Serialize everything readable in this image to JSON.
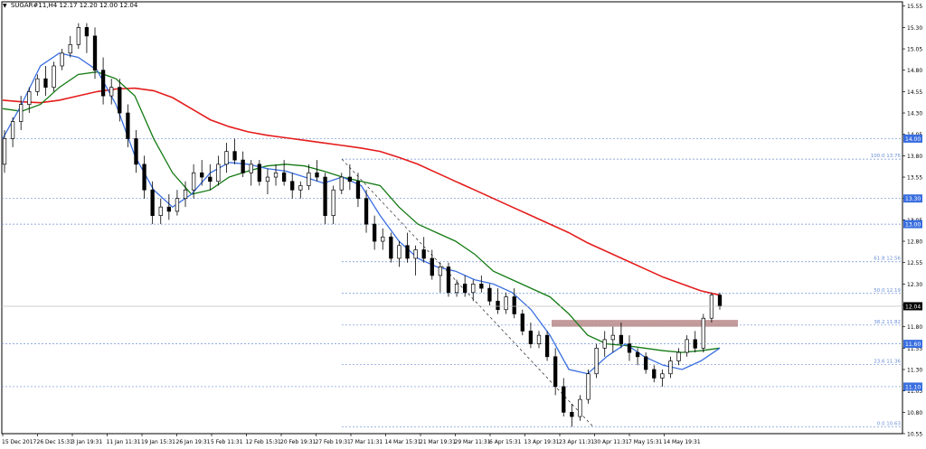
{
  "header": {
    "symbol": "SUGAR#11,H4",
    "ohlc": "12.17 12.20 12.00 12.04"
  },
  "icons": {
    "menu": "triangle-down-icon"
  },
  "colors": {
    "background": "#ffffff",
    "grid": "#6b8fd6",
    "candle": "#000000",
    "ma_red": "#e51c1c",
    "ma_green": "#137a13",
    "ma_blue": "#3a6fe0",
    "zone": "#b98a8a",
    "price_label_bg": "#3a6fe0",
    "current_label_bg": "#000000"
  },
  "chart_data": {
    "type": "candlestick",
    "symbol": "SUGAR#11",
    "timeframe": "H4",
    "ylim": [
      10.55,
      15.6
    ],
    "y_ticks": [
      "15.55",
      "15.30",
      "15.05",
      "14.80",
      "14.55",
      "14.30",
      "14.05",
      "13.80",
      "13.55",
      "13.30",
      "13.05",
      "12.80",
      "12.55",
      "12.30",
      "12.05",
      "11.80",
      "11.55",
      "11.30",
      "11.05",
      "10.80",
      "10.55"
    ],
    "x_tick_labels": [
      "15 Dec 2017",
      "26 Dec 15:31",
      "3 Jan 19:31",
      "11 Jan 11:31",
      "19 Jan 15:31",
      "26 Jan 19:31",
      "5 Feb 11:31",
      "12 Feb 15:31",
      "20 Feb 19:31",
      "27 Feb 19:31",
      "7 Mar 11:31",
      "14 Mar 15:31",
      "21 Mar 19:31",
      "29 Mar 11:31",
      "6 Apr 15:31",
      "13 Apr 19:31",
      "23 Apr 11:31",
      "30 Apr 11:31",
      "7 May 15:31",
      "14 May 19:31"
    ],
    "price_level_labels": [
      {
        "text": "14.00",
        "value": 14.0
      },
      {
        "text": "13.30",
        "value": 13.3
      },
      {
        "text": "13.00",
        "value": 13.0
      },
      {
        "text": "11.60",
        "value": 11.6
      },
      {
        "text": "11.10",
        "value": 11.1
      }
    ],
    "current_price": {
      "text": "12.04",
      "value": 12.04
    },
    "fibonacci": [
      {
        "label": "100.0 13.76",
        "value": 13.76
      },
      {
        "label": "61.8 12.56",
        "value": 12.56
      },
      {
        "label": "50.0 12.19",
        "value": 12.19
      },
      {
        "label": "38.2 11.82",
        "value": 11.82
      },
      {
        "label": "23.6 11.36",
        "value": 11.36
      },
      {
        "label": "0.0 10.63",
        "value": 10.63
      }
    ],
    "resistance_zone": {
      "from": 11.8,
      "to": 11.88
    },
    "trendline": {
      "from_price": 13.76,
      "to_price": 10.63
    },
    "series": [
      {
        "name": "MA red",
        "values": [
          14.45,
          14.43,
          14.42,
          14.45,
          14.5,
          14.55,
          14.58,
          14.59,
          14.56,
          14.48,
          14.35,
          14.22,
          14.14,
          14.08,
          14.04,
          14.01,
          13.98,
          13.95,
          13.92,
          13.89,
          13.85,
          13.78,
          13.7,
          13.6,
          13.5,
          13.4,
          13.3,
          13.2,
          13.1,
          13.0,
          12.9,
          12.78,
          12.68,
          12.58,
          12.48,
          12.38,
          12.3,
          12.22,
          12.17
        ]
      },
      {
        "name": "MA green",
        "values": [
          14.35,
          14.32,
          14.4,
          14.6,
          14.75,
          14.78,
          14.7,
          14.5,
          14.0,
          13.6,
          13.35,
          13.4,
          13.55,
          13.62,
          13.68,
          13.7,
          13.68,
          13.62,
          13.55,
          13.5,
          13.45,
          13.2,
          13.0,
          12.9,
          12.8,
          12.65,
          12.45,
          12.35,
          12.25,
          12.15,
          11.95,
          11.7,
          11.6,
          11.58,
          11.55,
          11.52,
          11.5,
          11.52,
          11.55
        ]
      },
      {
        "name": "MA blue",
        "values": [
          14.0,
          14.4,
          14.85,
          15.0,
          14.95,
          14.8,
          14.4,
          13.8,
          13.4,
          13.2,
          13.35,
          13.6,
          13.72,
          13.7,
          13.65,
          13.62,
          13.55,
          13.48,
          13.55,
          13.45,
          13.1,
          12.8,
          12.6,
          12.5,
          12.45,
          12.35,
          12.3,
          12.2,
          12.0,
          11.7,
          11.3,
          11.25,
          11.45,
          11.6,
          11.45,
          11.35,
          11.3,
          11.4,
          11.55
        ]
      }
    ],
    "candles": [
      [
        13.7,
        14.1,
        13.6,
        14.0
      ],
      [
        14.0,
        14.25,
        13.9,
        14.2
      ],
      [
        14.2,
        14.5,
        14.1,
        14.4
      ],
      [
        14.4,
        14.6,
        14.3,
        14.55
      ],
      [
        14.55,
        14.75,
        14.5,
        14.7
      ],
      [
        14.7,
        14.85,
        14.5,
        14.6
      ],
      [
        14.6,
        14.9,
        14.55,
        14.85
      ],
      [
        14.85,
        15.05,
        14.8,
        15.0
      ],
      [
        15.0,
        15.2,
        14.95,
        15.1
      ],
      [
        15.1,
        15.35,
        15.05,
        15.3
      ],
      [
        15.3,
        15.35,
        15.0,
        15.2
      ],
      [
        15.2,
        15.3,
        14.7,
        14.8
      ],
      [
        14.8,
        14.95,
        14.4,
        14.5
      ],
      [
        14.5,
        14.7,
        14.4,
        14.6
      ],
      [
        14.6,
        14.7,
        14.2,
        14.3
      ],
      [
        14.3,
        14.4,
        13.9,
        14.0
      ],
      [
        14.0,
        14.1,
        13.6,
        13.7
      ],
      [
        13.7,
        13.8,
        13.3,
        13.4
      ],
      [
        13.4,
        13.5,
        13.0,
        13.1
      ],
      [
        13.1,
        13.3,
        13.0,
        13.2
      ],
      [
        13.2,
        13.35,
        13.05,
        13.15
      ],
      [
        13.15,
        13.4,
        13.1,
        13.3
      ],
      [
        13.3,
        13.5,
        13.2,
        13.4
      ],
      [
        13.4,
        13.7,
        13.3,
        13.6
      ],
      [
        13.6,
        13.75,
        13.45,
        13.55
      ],
      [
        13.55,
        13.7,
        13.4,
        13.5
      ],
      [
        13.5,
        13.8,
        13.45,
        13.7
      ],
      [
        13.7,
        13.95,
        13.6,
        13.85
      ],
      [
        13.85,
        14.0,
        13.7,
        13.75
      ],
      [
        13.75,
        13.85,
        13.55,
        13.6
      ],
      [
        13.6,
        13.75,
        13.45,
        13.7
      ],
      [
        13.7,
        13.75,
        13.45,
        13.5
      ],
      [
        13.5,
        13.65,
        13.35,
        13.55
      ],
      [
        13.55,
        13.7,
        13.45,
        13.6
      ],
      [
        13.6,
        13.75,
        13.45,
        13.5
      ],
      [
        13.5,
        13.6,
        13.3,
        13.4
      ],
      [
        13.4,
        13.5,
        13.3,
        13.45
      ],
      [
        13.45,
        13.7,
        13.4,
        13.6
      ],
      [
        13.6,
        13.75,
        13.5,
        13.55
      ],
      [
        13.55,
        13.6,
        13.0,
        13.1
      ],
      [
        13.1,
        13.45,
        13.0,
        13.4
      ],
      [
        13.4,
        13.6,
        13.35,
        13.55
      ],
      [
        13.55,
        13.7,
        13.4,
        13.5
      ],
      [
        13.5,
        13.6,
        13.2,
        13.3
      ],
      [
        13.3,
        13.4,
        12.9,
        13.0
      ],
      [
        13.0,
        13.1,
        12.7,
        12.8
      ],
      [
        12.8,
        12.95,
        12.7,
        12.85
      ],
      [
        12.85,
        12.9,
        12.55,
        12.6
      ],
      [
        12.6,
        12.8,
        12.5,
        12.75
      ],
      [
        12.75,
        12.9,
        12.55,
        12.6
      ],
      [
        12.6,
        12.75,
        12.4,
        12.7
      ],
      [
        12.7,
        12.85,
        12.55,
        12.6
      ],
      [
        12.6,
        12.7,
        12.35,
        12.4
      ],
      [
        12.4,
        12.55,
        12.2,
        12.5
      ],
      [
        12.5,
        12.55,
        12.15,
        12.2
      ],
      [
        12.2,
        12.35,
        12.15,
        12.3
      ],
      [
        12.3,
        12.4,
        12.15,
        12.2
      ],
      [
        12.2,
        12.35,
        12.1,
        12.3
      ],
      [
        12.3,
        12.4,
        12.2,
        12.25
      ],
      [
        12.25,
        12.3,
        12.05,
        12.1
      ],
      [
        12.1,
        12.25,
        11.95,
        12.0
      ],
      [
        12.0,
        12.2,
        11.95,
        12.15
      ],
      [
        12.15,
        12.25,
        11.9,
        11.95
      ],
      [
        11.95,
        12.0,
        11.7,
        11.75
      ],
      [
        11.75,
        11.85,
        11.55,
        11.6
      ],
      [
        11.6,
        11.75,
        11.55,
        11.7
      ],
      [
        11.7,
        11.75,
        11.4,
        11.45
      ],
      [
        11.45,
        11.55,
        11.0,
        11.1
      ],
      [
        11.1,
        11.2,
        10.75,
        10.8
      ],
      [
        10.8,
        10.9,
        10.63,
        10.75
      ],
      [
        10.75,
        11.0,
        10.7,
        10.95
      ],
      [
        10.95,
        11.3,
        10.9,
        11.25
      ],
      [
        11.25,
        11.6,
        11.2,
        11.55
      ],
      [
        11.55,
        11.75,
        11.45,
        11.65
      ],
      [
        11.65,
        11.8,
        11.5,
        11.7
      ],
      [
        11.7,
        11.85,
        11.55,
        11.6
      ],
      [
        11.6,
        11.7,
        11.4,
        11.5
      ],
      [
        11.5,
        11.55,
        11.35,
        11.45
      ],
      [
        11.45,
        11.5,
        11.25,
        11.3
      ],
      [
        11.3,
        11.35,
        11.15,
        11.2
      ],
      [
        11.2,
        11.3,
        11.1,
        11.25
      ],
      [
        11.25,
        11.45,
        11.2,
        11.4
      ],
      [
        11.4,
        11.55,
        11.35,
        11.5
      ],
      [
        11.5,
        11.7,
        11.45,
        11.65
      ],
      [
        11.65,
        11.75,
        11.5,
        11.55
      ],
      [
        11.55,
        11.95,
        11.5,
        11.9
      ],
      [
        11.9,
        12.2,
        11.85,
        12.17
      ],
      [
        12.17,
        12.2,
        12.0,
        12.04
      ]
    ]
  }
}
